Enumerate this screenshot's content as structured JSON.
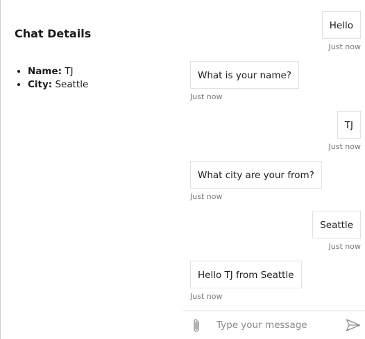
{
  "details": {
    "title": "Chat Details",
    "items": [
      {
        "label": "Name:",
        "value": " TJ"
      },
      {
        "label": "City:",
        "value": " Seattle"
      }
    ]
  },
  "messages": [
    {
      "side": "right",
      "text": "Hello",
      "time": "Just now"
    },
    {
      "side": "left",
      "text": "What is your name?",
      "time": "Just now"
    },
    {
      "side": "right",
      "text": "TJ",
      "time": "Just now"
    },
    {
      "side": "left",
      "text": "What city are your from?",
      "time": "Just now"
    },
    {
      "side": "right",
      "text": "Seattle",
      "time": "Just now"
    },
    {
      "side": "left",
      "text": "Hello TJ from Seattle",
      "time": "Just now"
    }
  ],
  "composer": {
    "placeholder": "Type your message",
    "value": "",
    "attach_icon": "paperclip-icon",
    "send_icon": "send-icon"
  },
  "colors": {
    "bubble_border": "#e1e1e1",
    "timestamp": "#777777",
    "icon": "#8a8a8a"
  }
}
